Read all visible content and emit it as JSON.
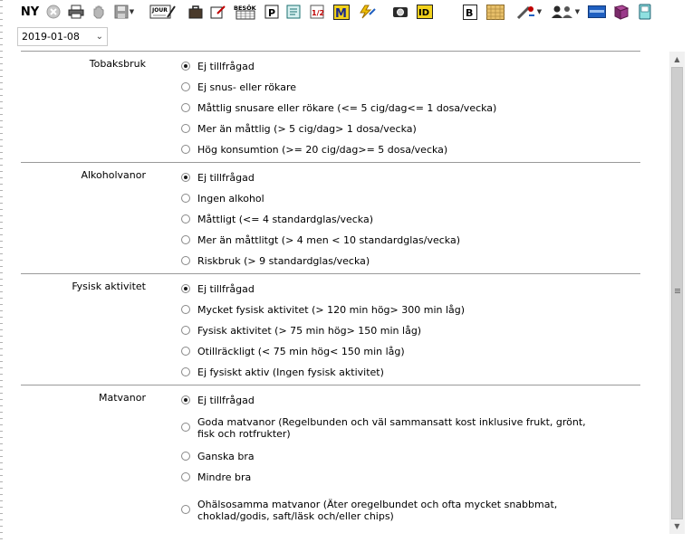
{
  "toolbar": {
    "new_label": "NY",
    "icons": [
      "cancel-icon",
      "print-icon",
      "hand-icon",
      "save-icon",
      "journal-icon",
      "briefcase-icon",
      "edit-note-icon",
      "visit-schedule-icon",
      "p-document-icon",
      "notes-icon",
      "numbers-icon",
      "m-icon",
      "lightning-icon",
      "camera-icon",
      "id-icon",
      "b-icon",
      "grid-icon",
      "measurement-icon",
      "people-icon",
      "card-icon",
      "book-icon",
      "phone-icon"
    ],
    "visit_schedule_text": "BESÖK",
    "journal_text": "JOUR",
    "p_text": "P",
    "numbers_text": "1/2",
    "m_text": "M",
    "id_text": "ID",
    "b_text": "B"
  },
  "date": {
    "value": "2019-01-08"
  },
  "sections": [
    {
      "label": "Tobaksbruk",
      "options": [
        {
          "text": "Ej tillfrågad",
          "checked": true
        },
        {
          "text": "Ej snus- eller rökare",
          "checked": false
        },
        {
          "text": "Måttlig snusare eller rökare (<= 5 cig/dag<= 1 dosa/vecka)",
          "checked": false
        },
        {
          "text": "Mer än måttlig (> 5 cig/dag> 1 dosa/vecka)",
          "checked": false
        },
        {
          "text": "Hög konsumtion (>= 20 cig/dag>= 5 dosa/vecka)",
          "checked": false
        }
      ]
    },
    {
      "label": "Alkoholvanor",
      "options": [
        {
          "text": "Ej tillfrågad",
          "checked": true
        },
        {
          "text": "Ingen alkohol",
          "checked": false
        },
        {
          "text": "Måttligt (<= 4 standardglas/vecka)",
          "checked": false
        },
        {
          "text": "Mer än måttlitgt (> 4 men < 10 standardglas/vecka)",
          "checked": false
        },
        {
          "text": "Riskbruk (> 9 standardglas/vecka)",
          "checked": false
        }
      ]
    },
    {
      "label": "Fysisk aktivitet",
      "options": [
        {
          "text": "Ej tillfrågad",
          "checked": true
        },
        {
          "text": "Mycket fysisk aktivitet (> 120 min hög> 300 min låg)",
          "checked": false
        },
        {
          "text": "Fysisk aktivitet (> 75 min hög> 150 min låg)",
          "checked": false
        },
        {
          "text": "Otillräckligt (< 75 min hög< 150 min låg)",
          "checked": false
        },
        {
          "text": "Ej fysiskt aktiv (Ingen fysisk aktivitet)",
          "checked": false
        }
      ]
    },
    {
      "label": "Matvanor",
      "options": [
        {
          "text": "Ej tillfrågad",
          "checked": true
        },
        {
          "text": "Goda matvanor (Regelbunden och väl sammansatt kost inklusive frukt, grönt, fisk och rotfrukter)",
          "checked": false
        },
        {
          "text": "Ganska bra",
          "checked": false
        },
        {
          "text": "Mindre bra",
          "checked": false
        },
        {
          "text": "Ohälsosamma matvanor (Äter oregelbundet och ofta mycket snabbmat, choklad/godis, saft/läsk och/eller chips)",
          "checked": false
        }
      ]
    }
  ],
  "colors": {
    "accent_blue": "#1f5fc0",
    "radio_border": "#8a8a8a",
    "divider": "#9a9a9a",
    "scroll_thumb": "#cdcdcd"
  }
}
